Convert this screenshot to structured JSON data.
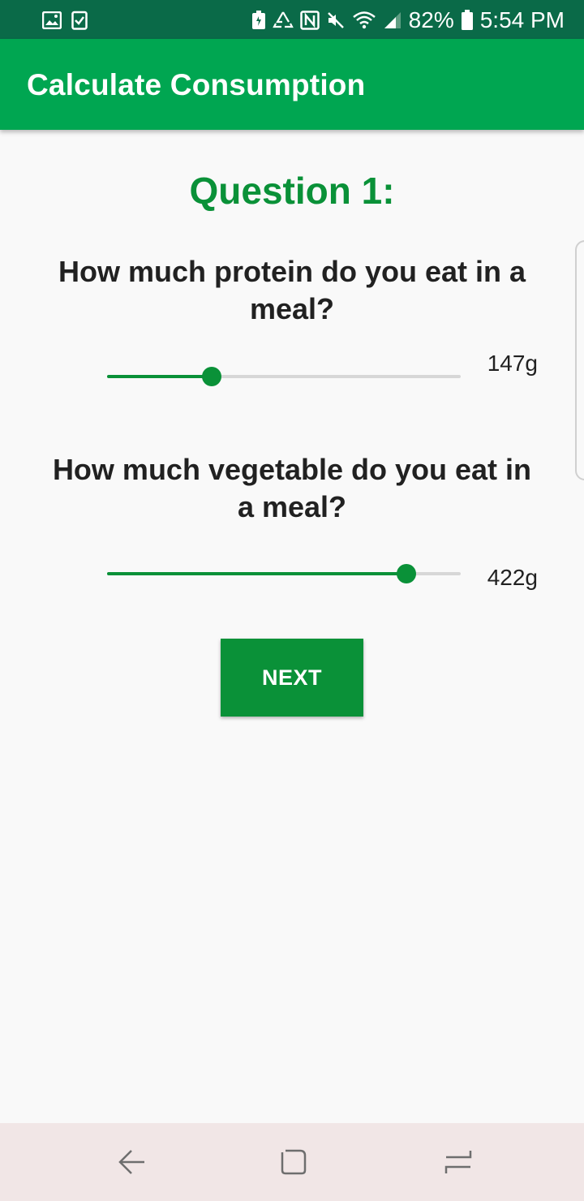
{
  "status_bar": {
    "battery_percent": "82%",
    "time": "5:54 PM",
    "left_icons": [
      "image-icon",
      "checklist-icon"
    ],
    "right_icons": [
      "battery-saver-icon",
      "recycle-icon",
      "nfc-icon",
      "mute-icon",
      "wifi-icon",
      "signal-icon",
      "battery-icon"
    ]
  },
  "app_bar": {
    "title": "Calculate Consumption"
  },
  "main": {
    "question_title": "Question 1:",
    "questions": [
      {
        "text": "How much protein do you eat in a meal?",
        "value_label": "147g",
        "slider_fraction": 0.295
      },
      {
        "text": "How much vegetable do you eat in a meal?",
        "value_label": "422g",
        "slider_fraction": 0.846
      }
    ],
    "next_label": "NEXT"
  },
  "colors": {
    "status_bar": "#0a6a48",
    "app_bar": "#00a651",
    "accent": "#0a9138",
    "track": "#d7d7d7",
    "background": "#f9f9f9",
    "nav_bar": "#f1e6e6"
  },
  "nav_bar": {
    "icons": [
      "back-icon",
      "home-icon",
      "recent-apps-icon"
    ]
  }
}
